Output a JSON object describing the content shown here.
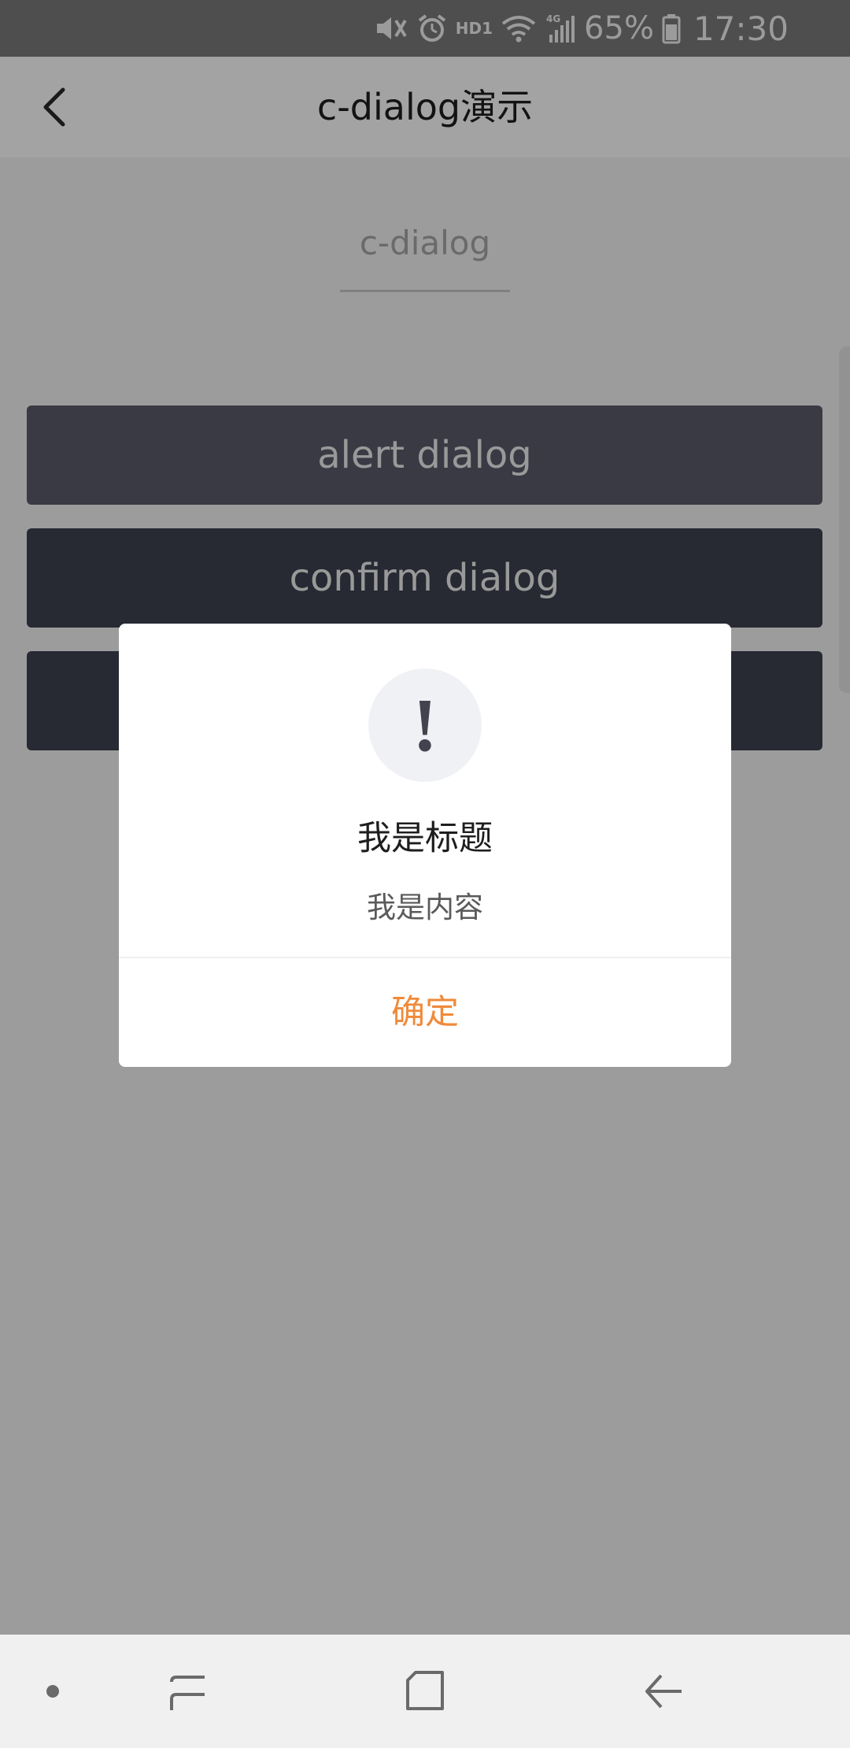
{
  "status_bar": {
    "icons": [
      "mute-icon",
      "alarm-icon",
      "hd-icon",
      "wifi-icon",
      "signal-4g-icon",
      "battery-icon"
    ],
    "hd_label": "HD1",
    "battery_percent": "65%",
    "time": "17:30"
  },
  "header": {
    "title": "c-dialog演示",
    "back_icon": "back-arrow-icon"
  },
  "section": {
    "label": "c-dialog"
  },
  "buttons": [
    {
      "label": "alert dialog"
    },
    {
      "label": "confirm dialog"
    },
    {
      "label": ""
    }
  ],
  "dialog": {
    "icon": "exclamation-icon",
    "icon_glyph": "!",
    "title": "我是标题",
    "content": "我是内容",
    "confirm_label": "确定",
    "confirm_color": "#f08a3a"
  },
  "nav_bar": {
    "items": [
      "dot-icon",
      "recents-icon",
      "home-icon",
      "back-icon"
    ]
  }
}
